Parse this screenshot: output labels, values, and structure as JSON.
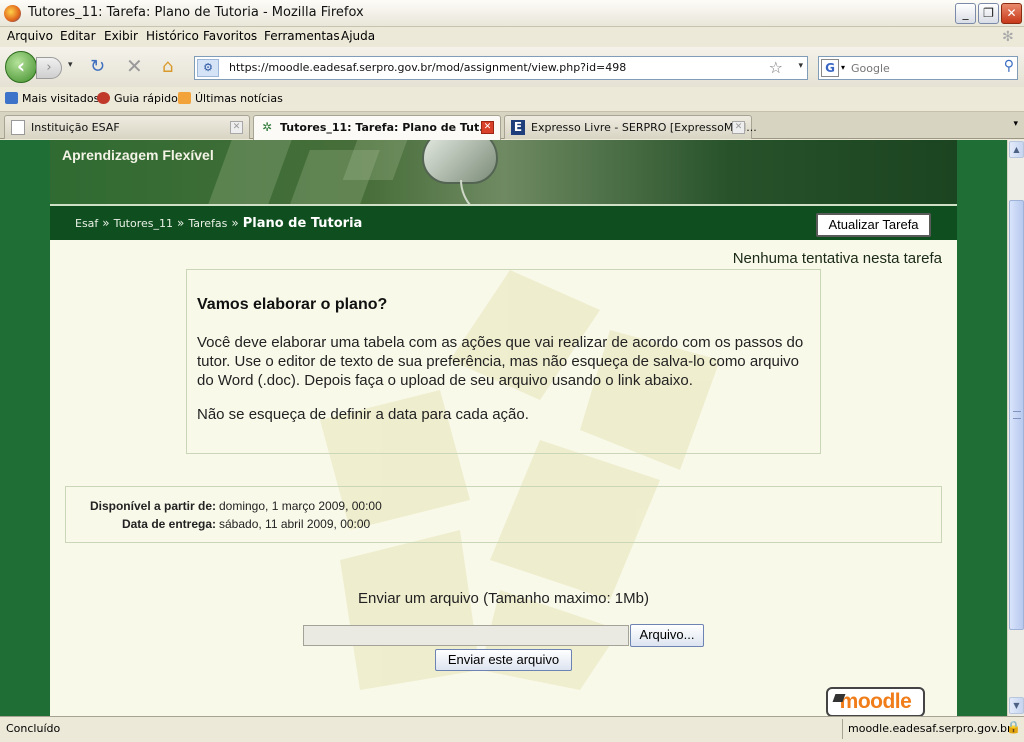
{
  "window": {
    "title": "Tutores_11: Tarefa: Plano de Tutoria - Mozilla Firefox",
    "minimize": "_",
    "restore": "❐",
    "close": "✕"
  },
  "menu": [
    "Arquivo",
    "Editar",
    "Exibir",
    "Histórico",
    "Favoritos",
    "Ferramentas",
    "Ajuda"
  ],
  "nav": {
    "url": "https://moodle.eadesaf.serpro.gov.br/mod/assignment/view.php?id=498",
    "search_placeholder": "Google"
  },
  "bookmarks": [
    "Mais visitados",
    "Guia rápido",
    "Últimas notícias"
  ],
  "tabs": [
    {
      "label": "Instituição ESAF",
      "active": false
    },
    {
      "label": "Tutores_11: Tarefa: Plano de Tut...",
      "active": true
    },
    {
      "label": "Expresso Livre - SERPRO [ExpressoMail...",
      "active": false
    }
  ],
  "page": {
    "banner_subtitle": "Aprendizagem Flexível",
    "breadcrumb": {
      "items": [
        "Esaf",
        "Tutores_11",
        "Tarefas"
      ],
      "separator": "»",
      "current": "Plano de Tutoria"
    },
    "update_button": "Atualizar Tarefa",
    "no_attempts": "Nenhuma tentativa nesta tarefa",
    "intro": {
      "heading": "Vamos elaborar o plano?",
      "paragraph1": "Você deve elaborar uma tabela com as ações que vai realizar de acordo com os passos do tutor. Use o editor de texto de sua preferência, mas não esqueça de salva-lo como arquivo do Word (.doc). Depois faça o upload de seu arquivo usando o link abaixo.",
      "paragraph2": "Não se esqueça de definir a data para cada ação."
    },
    "dates": {
      "available_label": "Disponível a partir de:",
      "available_value": "domingo, 1 março 2009, 00:00",
      "due_label": "Data de entrega:",
      "due_value": "sábado, 11 abril 2009, 00:00"
    },
    "upload": {
      "title": "Enviar um arquivo (Tamanho maximo: 1Mb)",
      "browse_button": "Arquivo...",
      "send_button": "Enviar este arquivo"
    },
    "logo_text": "moodle"
  },
  "status": {
    "left": "Concluído",
    "right": "moodle.eadesaf.serpro.gov.br"
  },
  "colors": {
    "page_background": "#1e6e35",
    "content_background": "#f9f9ea",
    "breadcrumb_bar": "#0f4f1f",
    "moodle_orange": "#f07d1a"
  }
}
